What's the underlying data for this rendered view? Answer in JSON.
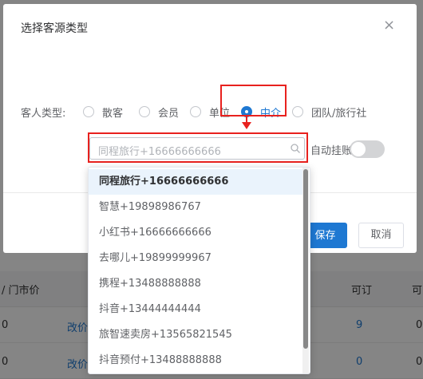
{
  "dialog": {
    "title": "选择客源类型",
    "close_glyph": "×",
    "guest_type_label": "客人类型:",
    "radio_options": [
      {
        "label": "散客",
        "checked": false
      },
      {
        "label": "会员",
        "checked": false
      },
      {
        "label": "单位",
        "checked": false
      },
      {
        "label": "中介",
        "checked": true
      },
      {
        "label": "团队/旅行社",
        "checked": false
      }
    ],
    "select_value": "同程旅行+16666666666",
    "auto_post_label": "自动挂账",
    "auto_post_on": false,
    "save_label": "保存",
    "cancel_label": "取消"
  },
  "dropdown": {
    "items": [
      "同程旅行+16666666666",
      "智慧+19898986767",
      "小红书+16666666666",
      "去哪儿+19899999967",
      "携程+13488888888",
      "抖音+13444444444",
      "旅智速卖房+13565821545",
      "抖音预付+13488888888"
    ],
    "selected_index": 0
  },
  "background_table": {
    "header_partial": "/ 门市价",
    "header_available": "可订",
    "header_cut": "可",
    "rows": [
      {
        "first": "0",
        "link": "改价",
        "available": "9",
        "last": "0"
      },
      {
        "first": "0",
        "link": "改价",
        "available": "0",
        "last": "0"
      }
    ]
  },
  "colors": {
    "primary": "#1e78d2",
    "annotation": "#e8211e",
    "overlay": "rgba(0,0,0,0.48)"
  }
}
